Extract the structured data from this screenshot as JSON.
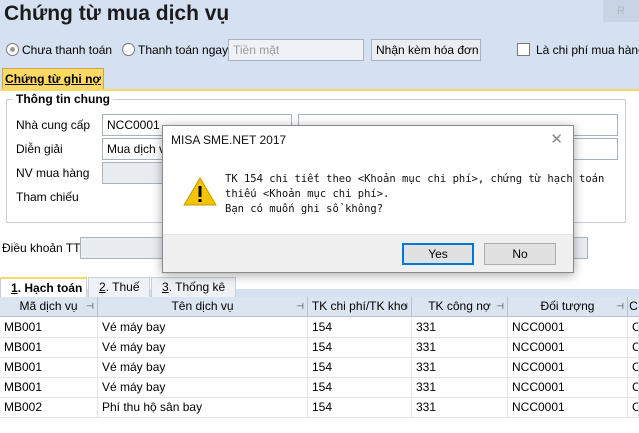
{
  "title": "Chứng từ mua dịch vụ",
  "window_control": "R",
  "payment": {
    "option_unpaid": "Chưa thanh toán",
    "option_paid": "Thanh toán ngay",
    "method_value": "Tiền mặt",
    "invoice_value": "Nhận kèm hóa đơn",
    "purchase_cost_label": "Là chi phí mua hàng"
  },
  "voucher_tab": "Chứng từ ghi nợ",
  "general": {
    "group_title": "Thông tin chung",
    "supplier_label": "Nhà cung cấp",
    "supplier_value": "NCC0001",
    "description_label": "Diễn giải",
    "description_value": "Mua dịch v",
    "staff_label": "NV mua hàng",
    "reference_label": "Tham chiếu"
  },
  "terms_label": "Điều khoản TT",
  "detail_tabs": [
    {
      "num": "1",
      "label": ". Hạch toán"
    },
    {
      "num": "2",
      "label": ". Thuế"
    },
    {
      "num": "3",
      "label": ". Thống kê"
    }
  ],
  "grid": {
    "columns": [
      "Mã dịch vụ",
      "Tên dịch vụ",
      "TK chi phí/TK kho",
      "TK công nợ",
      "Đối tượng",
      "C"
    ],
    "rows": [
      [
        "MB001",
        "Vé máy bay",
        "154",
        "331",
        "NCC0001",
        "C"
      ],
      [
        "MB001",
        "Vé máy bay",
        "154",
        "331",
        "NCC0001",
        "C"
      ],
      [
        "MB001",
        "Vé máy bay",
        "154",
        "331",
        "NCC0001",
        "C"
      ],
      [
        "MB001",
        "Vé máy bay",
        "154",
        "331",
        "NCC0001",
        "C"
      ],
      [
        "MB002",
        "Phí thu hộ sân bay",
        "154",
        "331",
        "NCC0001",
        "C"
      ]
    ]
  },
  "dialog": {
    "title": "MISA SME.NET 2017",
    "icon": "warning-icon",
    "message_lines": [
      "TK 154 chi tiết theo <Khoản mục chi phí>, chứng từ hạch toán",
      "thiếu <Khoản mục chi phí>.",
      "Bạn có muốn ghi sổ không?"
    ],
    "yes_label": "Yes",
    "no_label": "No"
  },
  "colors": {
    "accent": "#ffd966",
    "warning": "#f5c400",
    "default_button_border": "#0078d7"
  }
}
